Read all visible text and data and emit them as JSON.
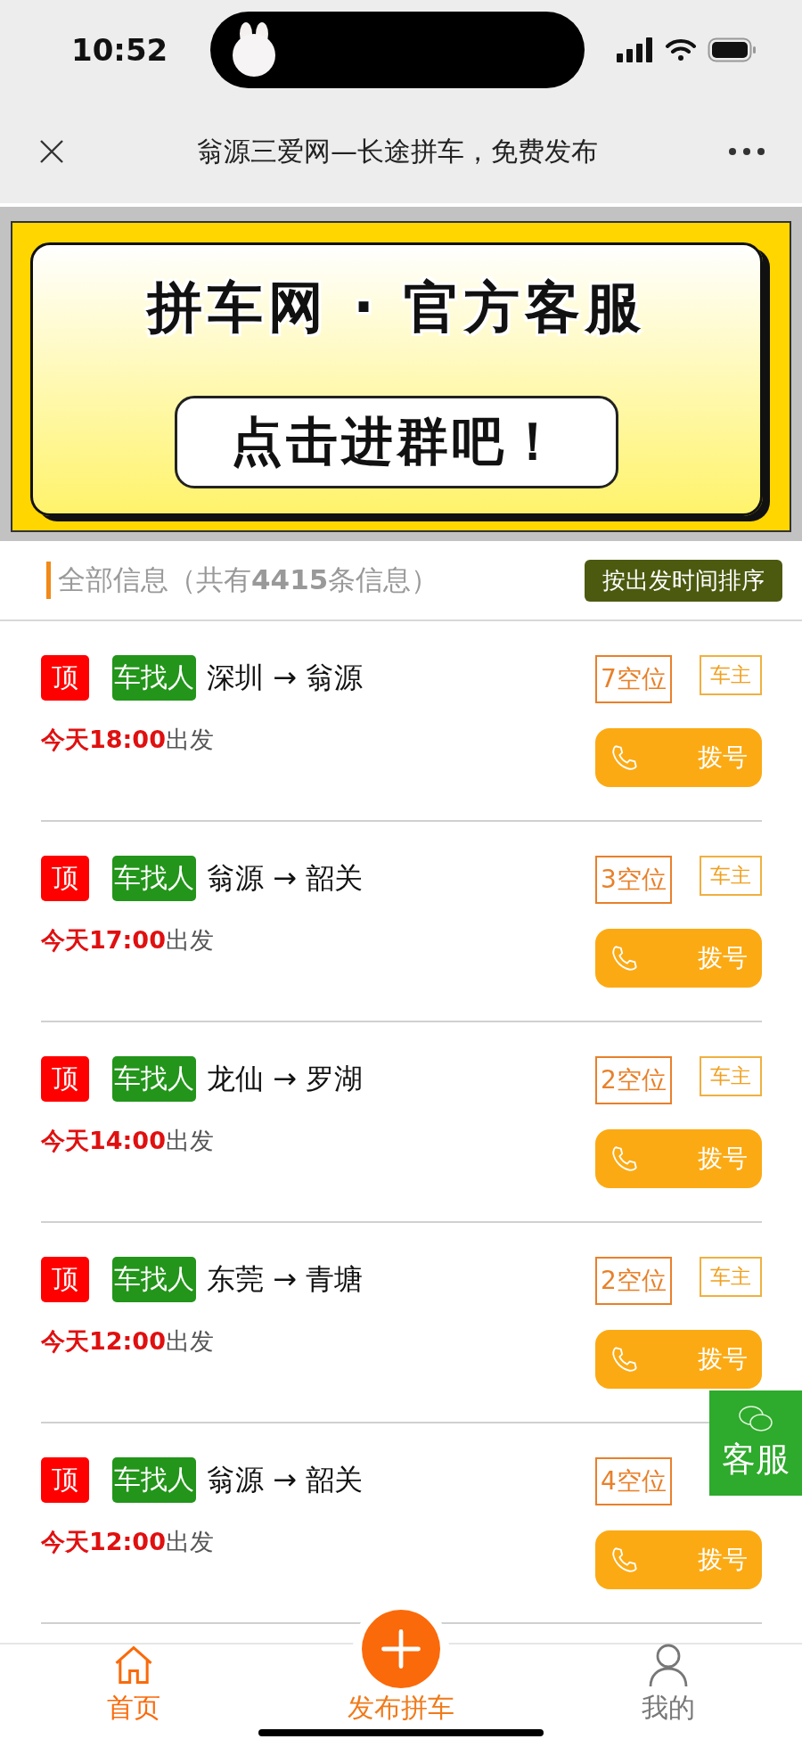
{
  "status_bar": {
    "time": "10:52"
  },
  "nav": {
    "title": "翁源三爱网—长途拼车，免费发布"
  },
  "banner": {
    "title": "拼车网 · 官方客服",
    "action": "点击进群吧！"
  },
  "list_header": {
    "label": "全部信息（共有**4415**条信息）",
    "sort_button": "按出发时间排序"
  },
  "items": [
    {
      "pin": "顶",
      "type": "车找人",
      "route": "深圳 → 翁源",
      "time": "今天18:00",
      "depart": "出发",
      "seats": "7空位",
      "owner": "车主",
      "dial": "拨号"
    },
    {
      "pin": "顶",
      "type": "车找人",
      "route": "翁源 → 韶关",
      "time": "今天17:00",
      "depart": "出发",
      "seats": "3空位",
      "owner": "车主",
      "dial": "拨号"
    },
    {
      "pin": "顶",
      "type": "车找人",
      "route": "龙仙 → 罗湖",
      "time": "今天14:00",
      "depart": "出发",
      "seats": "2空位",
      "owner": "车主",
      "dial": "拨号"
    },
    {
      "pin": "顶",
      "type": "车找人",
      "route": "东莞 → 青塘",
      "time": "今天12:00",
      "depart": "出发",
      "seats": "2空位",
      "owner": "车主",
      "dial": "拨号"
    },
    {
      "pin": "顶",
      "type": "车找人",
      "route": "翁源 → 韶关",
      "time": "今天12:00",
      "depart": "出发",
      "seats": "4空位",
      "dial": "拨号"
    }
  ],
  "float_button": {
    "label": "客服"
  },
  "tabs": [
    {
      "label": "首页",
      "selected": true,
      "kind": "home"
    },
    {
      "label": "发布拼车",
      "selected": false,
      "kind": "publish"
    },
    {
      "label": "我的",
      "selected": false,
      "kind": "profile"
    }
  ]
}
